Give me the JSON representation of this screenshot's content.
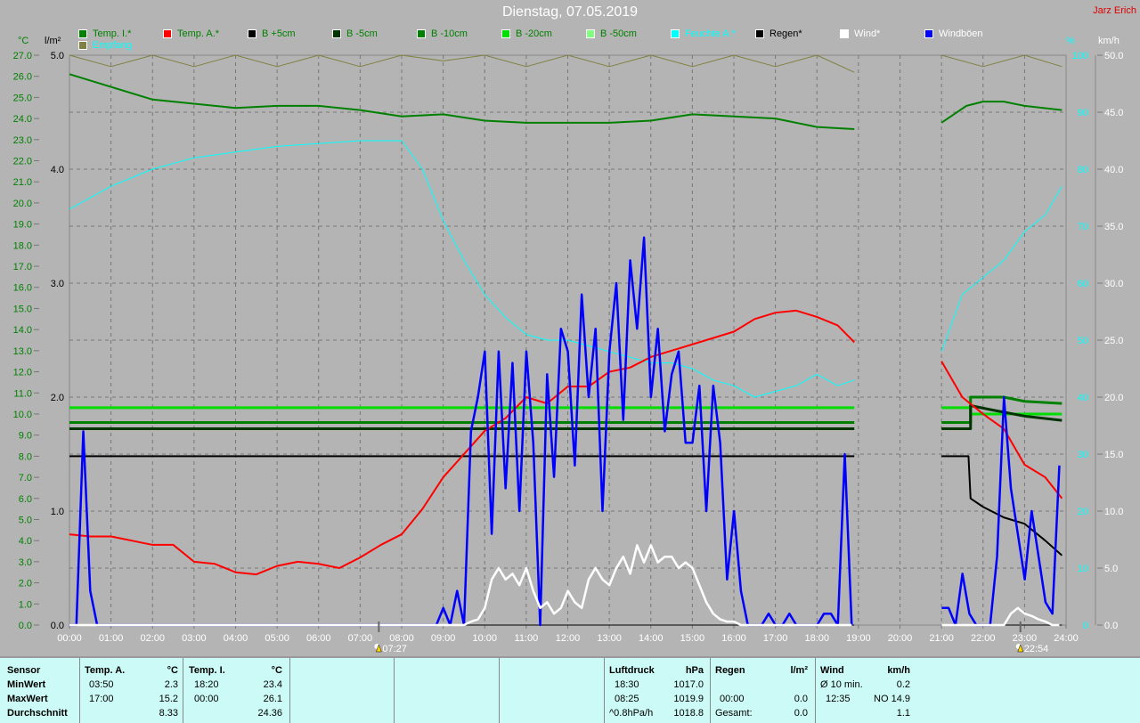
{
  "title": "Dienstag, 07.05.2019",
  "author": "Jarz Erich",
  "legend": [
    {
      "label": "Temp. I.*",
      "color": "#008000",
      "text_color": "#008000"
    },
    {
      "label": "Temp. A.*",
      "color": "#ff0000",
      "text_color": "#008000"
    },
    {
      "label": "B +5cm",
      "color": "#000000",
      "text_color": "#008000"
    },
    {
      "label": "B -5cm",
      "color": "#003300",
      "text_color": "#008000"
    },
    {
      "label": "B -10cm",
      "color": "#008000",
      "text_color": "#008000"
    },
    {
      "label": "B -20cm",
      "color": "#00dd00",
      "text_color": "#008000"
    },
    {
      "label": "B -50cm",
      "color": "#80ff80",
      "text_color": "#008000"
    },
    {
      "label": "Feuchte A.*",
      "color": "#00ffff",
      "text_color": "#00ffff"
    },
    {
      "label": "Regen*",
      "color": "#000000",
      "text_color": "#000000"
    },
    {
      "label": "Wind*",
      "color": "#ffffff",
      "text_color": "#ffffff"
    },
    {
      "label": "Windböen",
      "color": "#0000ff",
      "text_color": "#ffffff"
    },
    {
      "label": "Empfang",
      "color": "#808040",
      "text_color": "#00ffff"
    }
  ],
  "axes": {
    "left1_unit": "°C",
    "left2_unit": "l/m²",
    "right1_unit": "%",
    "right2_unit": "km/h",
    "temp_range": [
      0,
      27
    ],
    "rain_range": [
      0,
      5
    ],
    "humidity_range": [
      0,
      100
    ],
    "wind_range": [
      0,
      50
    ],
    "x_ticks": [
      "00:00",
      "01:00",
      "02:00",
      "03:00",
      "04:00",
      "05:00",
      "06:00",
      "07:00",
      "08:00",
      "09:00",
      "10:00",
      "11:00",
      "12:00",
      "13:00",
      "14:00",
      "15:00",
      "16:00",
      "17:00",
      "18:00",
      "19:00",
      "20:00",
      "21:00",
      "22:00",
      "23:00",
      "24:00"
    ],
    "sunrise": "07:27",
    "sunset": "22:54"
  },
  "chart_data": {
    "type": "line",
    "title": "Dienstag, 07.05.2019",
    "x_unit": "hour",
    "xlim": [
      0,
      24
    ],
    "gap": [
      18.95,
      21.0
    ],
    "series": [
      {
        "name": "Temp. I.*",
        "axis": "temp",
        "color": "#008000",
        "width": 2,
        "points": [
          [
            0,
            26.1
          ],
          [
            1,
            25.5
          ],
          [
            2,
            24.9
          ],
          [
            3,
            24.7
          ],
          [
            4,
            24.5
          ],
          [
            5,
            24.6
          ],
          [
            6,
            24.6
          ],
          [
            7,
            24.4
          ],
          [
            8,
            24.1
          ],
          [
            9,
            24.2
          ],
          [
            10,
            23.9
          ],
          [
            11,
            23.8
          ],
          [
            12,
            23.8
          ],
          [
            13,
            23.8
          ],
          [
            14,
            23.9
          ],
          [
            15,
            24.2
          ],
          [
            16,
            24.1
          ],
          [
            17,
            24.0
          ],
          [
            18,
            23.6
          ],
          [
            18.9,
            23.5
          ],
          null,
          [
            21,
            23.8
          ],
          [
            21.6,
            24.6
          ],
          [
            22,
            24.8
          ],
          [
            22.5,
            24.8
          ],
          [
            23,
            24.6
          ],
          [
            23.9,
            24.4
          ]
        ]
      },
      {
        "name": "Feuchte A.*",
        "axis": "humidity",
        "color": "#00ffff",
        "width": 1,
        "points": [
          [
            0,
            73
          ],
          [
            1,
            77
          ],
          [
            2,
            80
          ],
          [
            3,
            82
          ],
          [
            4,
            83
          ],
          [
            5,
            84
          ],
          [
            6,
            84.5
          ],
          [
            7,
            85
          ],
          [
            8,
            85
          ],
          [
            8.5,
            80
          ],
          [
            9,
            71
          ],
          [
            9.5,
            64
          ],
          [
            10,
            58
          ],
          [
            10.5,
            54
          ],
          [
            11,
            51
          ],
          [
            11.5,
            50
          ],
          [
            12,
            50
          ],
          [
            12.5,
            49
          ],
          [
            13,
            48
          ],
          [
            13.5,
            47
          ],
          [
            14,
            46
          ],
          [
            14.5,
            46
          ],
          [
            15,
            45
          ],
          [
            15.5,
            43
          ],
          [
            16,
            42
          ],
          [
            16.5,
            40
          ],
          [
            17,
            41
          ],
          [
            17.5,
            42
          ],
          [
            18,
            44
          ],
          [
            18.5,
            42
          ],
          [
            18.9,
            43
          ],
          null,
          [
            21,
            48
          ],
          [
            21.5,
            58
          ],
          [
            22,
            61
          ],
          [
            22.5,
            64
          ],
          [
            23,
            69
          ],
          [
            23.5,
            72
          ],
          [
            23.9,
            77
          ]
        ]
      },
      {
        "name": "Empfang",
        "axis": "humidity",
        "color": "#808040",
        "width": 1,
        "points": [
          [
            0,
            100
          ],
          [
            1,
            98
          ],
          [
            2,
            100
          ],
          [
            3,
            98
          ],
          [
            4,
            100
          ],
          [
            5,
            98
          ],
          [
            6,
            100
          ],
          [
            7,
            98
          ],
          [
            8,
            100
          ],
          [
            9,
            99
          ],
          [
            10,
            100
          ],
          [
            11,
            98
          ],
          [
            12,
            100
          ],
          [
            13,
            98
          ],
          [
            14,
            100
          ],
          [
            15,
            98
          ],
          [
            16,
            100
          ],
          [
            17,
            98
          ],
          [
            18,
            100
          ],
          [
            18.9,
            97
          ],
          null,
          [
            21,
            100
          ],
          [
            22,
            98
          ],
          [
            23,
            100
          ],
          [
            23.9,
            98
          ]
        ]
      },
      {
        "name": "B -20cm",
        "axis": "temp",
        "color": "#00dd00",
        "width": 3,
        "points": [
          [
            0,
            10.3
          ],
          [
            18.9,
            10.3
          ],
          null,
          [
            21,
            10.3
          ],
          [
            21.7,
            10.3
          ],
          [
            21.7,
            10.0
          ],
          [
            23.9,
            10.0
          ]
        ]
      },
      {
        "name": "B -10cm",
        "axis": "temp",
        "color": "#008000",
        "width": 3,
        "points": [
          [
            0,
            9.6
          ],
          [
            18.9,
            9.6
          ],
          null,
          [
            21,
            9.6
          ],
          [
            21.7,
            9.6
          ],
          [
            21.7,
            10.8
          ],
          [
            22.5,
            10.8
          ],
          [
            23,
            10.6
          ],
          [
            23.9,
            10.5
          ]
        ]
      },
      {
        "name": "B -5cm",
        "axis": "temp",
        "color": "#003300",
        "width": 3,
        "points": [
          [
            0,
            9.3
          ],
          [
            18.9,
            9.3
          ],
          null,
          [
            21,
            9.3
          ],
          [
            21.7,
            9.3
          ],
          [
            21.7,
            10.4
          ],
          [
            22.2,
            10.2
          ],
          [
            23,
            9.9
          ],
          [
            23.9,
            9.7
          ]
        ]
      },
      {
        "name": "B +5cm",
        "axis": "temp",
        "color": "#000000",
        "width": 2,
        "points": [
          [
            0,
            8.0
          ],
          [
            18.9,
            8.0
          ],
          null,
          [
            21,
            8.0
          ],
          [
            21.65,
            8.0
          ],
          [
            21.7,
            6.0
          ],
          [
            22,
            5.6
          ],
          [
            22.5,
            5.1
          ],
          [
            23,
            4.8
          ],
          [
            23.5,
            4.0
          ],
          [
            23.9,
            3.3
          ]
        ]
      },
      {
        "name": "Temp. A.*",
        "axis": "temp",
        "color": "#ff0000",
        "width": 2,
        "points": [
          [
            0,
            4.3
          ],
          [
            0.5,
            4.2
          ],
          [
            1,
            4.2
          ],
          [
            1.5,
            4.0
          ],
          [
            2,
            3.8
          ],
          [
            2.5,
            3.8
          ],
          [
            3,
            3.0
          ],
          [
            3.5,
            2.9
          ],
          [
            4,
            2.5
          ],
          [
            4.5,
            2.4
          ],
          [
            5,
            2.8
          ],
          [
            5.5,
            3.0
          ],
          [
            6,
            2.9
          ],
          [
            6.5,
            2.7
          ],
          [
            7,
            3.2
          ],
          [
            7.5,
            3.8
          ],
          [
            8,
            4.3
          ],
          [
            8.5,
            5.5
          ],
          [
            9,
            7.0
          ],
          [
            9.5,
            8.1
          ],
          [
            10,
            9.2
          ],
          [
            10.5,
            9.8
          ],
          [
            11,
            10.8
          ],
          [
            11.5,
            10.5
          ],
          [
            12,
            11.3
          ],
          [
            12.5,
            11.3
          ],
          [
            13,
            12.0
          ],
          [
            13.5,
            12.2
          ],
          [
            14,
            12.7
          ],
          [
            14.5,
            13.0
          ],
          [
            15,
            13.3
          ],
          [
            15.5,
            13.6
          ],
          [
            16,
            13.9
          ],
          [
            16.5,
            14.5
          ],
          [
            17,
            14.8
          ],
          [
            17.5,
            14.9
          ],
          [
            18,
            14.6
          ],
          [
            18.5,
            14.2
          ],
          [
            18.9,
            13.4
          ],
          null,
          [
            21,
            12.5
          ],
          [
            21.5,
            10.8
          ],
          [
            22,
            10.0
          ],
          [
            22.5,
            9.3
          ],
          [
            23,
            7.6
          ],
          [
            23.5,
            7.0
          ],
          [
            23.9,
            6.0
          ]
        ]
      },
      {
        "name": "Regen*",
        "axis": "rain",
        "color": "#000000",
        "width": 1,
        "points": [
          [
            0,
            0
          ],
          [
            18.9,
            0
          ],
          null,
          [
            21,
            0
          ],
          [
            23.9,
            0
          ]
        ]
      },
      {
        "name": "Windböen",
        "axis": "wind",
        "color": "#0000ff",
        "width": 2.5,
        "step_hours": 0.1667,
        "values": [
          0,
          0,
          17,
          3,
          0,
          0,
          0,
          0,
          0,
          0,
          0,
          0,
          0,
          0,
          0,
          0,
          0,
          0,
          0,
          0,
          0,
          0,
          0,
          0,
          0,
          0,
          0,
          0,
          0,
          0,
          0,
          0,
          0,
          0,
          0,
          0,
          0,
          0,
          0,
          0,
          0,
          0,
          0,
          0,
          0,
          0,
          0,
          0,
          0,
          0,
          0,
          0,
          0,
          0,
          1.5,
          0,
          3,
          0,
          17,
          20,
          24,
          8,
          24,
          12,
          23,
          10,
          24,
          16,
          0,
          22,
          13,
          26,
          24,
          14,
          29,
          20,
          26,
          10,
          24,
          30,
          18,
          32,
          26,
          34,
          20,
          26,
          17,
          22,
          24,
          16,
          16,
          21,
          10,
          21,
          16,
          4,
          10,
          3,
          0,
          0,
          0,
          1,
          0,
          0,
          1,
          0,
          0,
          0,
          0,
          1,
          1,
          0,
          15,
          0,
          null,
          null,
          null,
          null,
          null,
          null,
          null,
          null,
          null,
          null,
          null,
          null,
          1.5,
          1.5,
          0,
          4.5,
          1,
          0,
          0,
          0,
          6,
          20,
          12,
          8,
          4,
          10,
          6,
          2,
          1,
          14
        ]
      },
      {
        "name": "Wind*",
        "axis": "wind",
        "color": "#ffffff",
        "width": 2.5,
        "step_hours": 0.1667,
        "values": [
          0,
          0,
          0,
          0,
          0,
          0,
          0,
          0,
          0,
          0,
          0,
          0,
          0,
          0,
          0,
          0,
          0,
          0,
          0,
          0,
          0,
          0,
          0,
          0,
          0,
          0,
          0,
          0,
          0,
          0,
          0,
          0,
          0,
          0,
          0,
          0,
          0,
          0,
          0,
          0,
          0,
          0,
          0,
          0,
          0,
          0,
          0,
          0,
          0,
          0,
          0,
          0,
          0,
          0,
          0,
          0,
          0,
          0,
          0.3,
          0.5,
          1.5,
          4,
          5,
          4,
          4.5,
          3.5,
          5,
          3,
          1.5,
          2,
          1,
          1.5,
          3,
          2,
          1.5,
          4,
          5,
          4,
          3.5,
          5,
          6,
          4.5,
          7,
          5.5,
          7,
          5.5,
          6,
          6,
          5,
          5.5,
          5,
          3.5,
          2,
          1,
          0.5,
          0.3,
          0.3,
          0,
          0,
          0,
          0,
          0,
          0,
          0,
          0,
          0,
          0,
          0,
          0,
          0,
          0,
          0,
          0,
          0,
          null,
          null,
          null,
          null,
          null,
          null,
          null,
          null,
          null,
          null,
          null,
          null,
          0,
          0,
          0,
          0,
          0,
          0,
          0,
          0,
          0,
          0,
          1,
          1.5,
          1,
          0.8,
          0.5,
          0.3,
          0,
          0
        ]
      }
    ]
  },
  "stats": {
    "sensor": {
      "h": "Sensor",
      "rows": [
        "MinWert",
        "MaxWert",
        "Durchschnitt"
      ]
    },
    "temp_a": {
      "h": "Temp. A.",
      "u": "°C",
      "min_t": "03:50",
      "min_v": "2.3",
      "max_t": "17:00",
      "max_v": "15.2",
      "avg": "8.33"
    },
    "temp_i": {
      "h": "Temp. I.",
      "u": "°C",
      "min_t": "18:20",
      "min_v": "23.4",
      "max_t": "00:00",
      "max_v": "26.1",
      "avg": "24.36"
    },
    "pressure": {
      "h": "Luftdruck",
      "u": "hPa",
      "min_t": "18:30",
      "min_v": "1017.0",
      "max_t": "08:25",
      "max_v": "1019.9",
      "trend": "^0.8hPa/h",
      "avg": "1018.8"
    },
    "rain": {
      "h": "Regen",
      "u": "l/m²",
      "max_t": "00:00",
      "max_v": "0.0",
      "total_l": "Gesamt:",
      "total": "0.0"
    },
    "wind": {
      "h": "Wind",
      "u": "km/h",
      "avg10_l": "Ø 10 min.",
      "avg10": "0.2",
      "max_t": "12:35",
      "max_v": "NO 14.9",
      "avg": "1.1"
    }
  }
}
